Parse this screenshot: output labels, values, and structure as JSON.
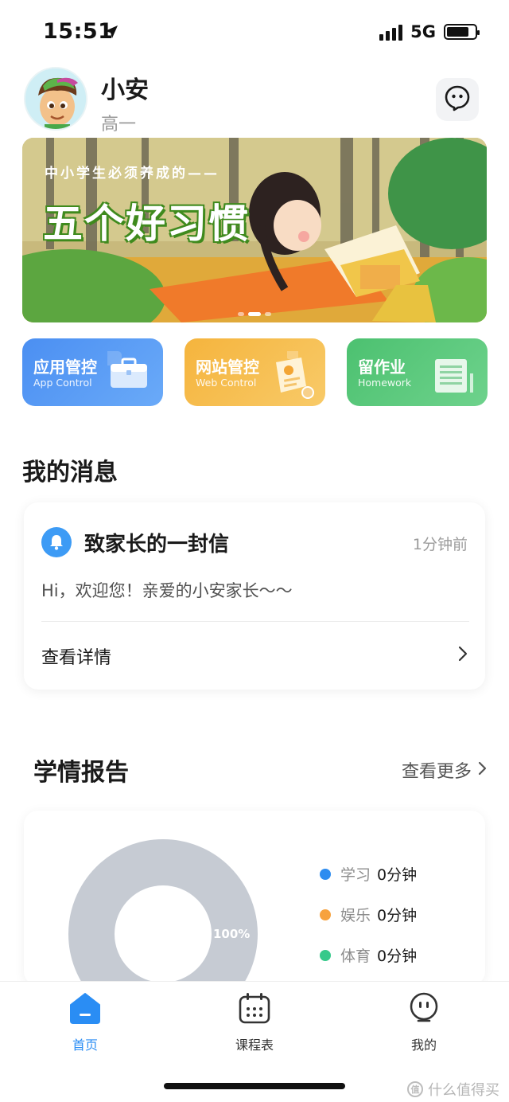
{
  "status_bar": {
    "time": "15:51",
    "network": "5G",
    "battery_level": 0.8,
    "icons": [
      "location-arrow-icon",
      "signal-icon",
      "battery-icon"
    ]
  },
  "header": {
    "name": "小安",
    "grade": "高一",
    "icons": [
      "avatar",
      "chat-face-icon"
    ]
  },
  "banner": {
    "subtitle": "中小学生必须养成的——",
    "title": "五个好习惯",
    "page_count": 3,
    "active_page": 2
  },
  "quick_actions": [
    {
      "title": "应用管控",
      "subtitle": "App Control",
      "icon": "briefcase-icon",
      "color": "#4b8ff2"
    },
    {
      "title": "网站管控",
      "subtitle": "Web Control",
      "icon": "certificate-icon",
      "color": "#f5b43d"
    },
    {
      "title": "留作业",
      "subtitle": "Homework",
      "icon": "notebook-icon",
      "color": "#4cc170"
    }
  ],
  "messages": {
    "section_title": "我的消息",
    "item": {
      "icon": "bell-icon",
      "title": "致家长的一封信",
      "time": "1分钟前",
      "body": "Hi，欢迎您！亲爱的小安家长～～",
      "link_label": "查看详情"
    }
  },
  "report": {
    "section_title": "学情报告",
    "more_label": "查看更多",
    "donut_label": "100%",
    "legend": [
      {
        "name": "学习",
        "value": "0分钟",
        "color": "#2d8cf0"
      },
      {
        "name": "娱乐",
        "value": "0分钟",
        "color": "#f7a23e"
      },
      {
        "name": "体育",
        "value": "0分钟",
        "color": "#36c98a"
      }
    ]
  },
  "tabbar": {
    "tabs": [
      {
        "label": "首页",
        "icon": "home-icon",
        "active": true
      },
      {
        "label": "课程表",
        "icon": "calendar-icon",
        "active": false
      },
      {
        "label": "我的",
        "icon": "profile-face-icon",
        "active": false
      }
    ]
  },
  "watermark": {
    "badge": "值",
    "text": "什么值得买"
  },
  "colors": {
    "accent": "#2a8df4",
    "donut_gray": "#c6cbd3"
  }
}
